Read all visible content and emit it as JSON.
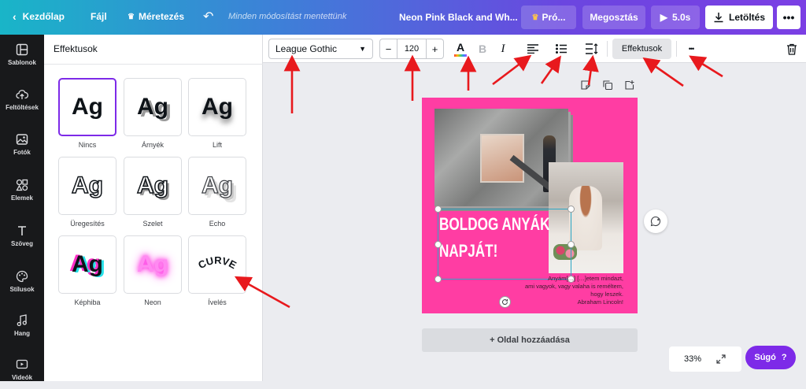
{
  "topbar": {
    "home_label": "Kezdőlap",
    "file_label": "Fájl",
    "resize_label": "Méretezés",
    "save_status": "Minden módosítást mentettünk",
    "doc_title": "Neon Pink Black and Wh...",
    "pro_label": "Pró...",
    "share_label": "Megosztás",
    "play_label": "5.0s",
    "download_label": "Letöltés"
  },
  "sidebar": {
    "items": [
      {
        "label": "Sablonok"
      },
      {
        "label": "Feltöltések"
      },
      {
        "label": "Fotók"
      },
      {
        "label": "Elemek"
      },
      {
        "label": "Szöveg"
      },
      {
        "label": "Stílusok"
      },
      {
        "label": "Hang"
      },
      {
        "label": "Videók"
      }
    ]
  },
  "panel": {
    "title": "Effektusok",
    "sample": "Ag",
    "curve_sample": "CURVE",
    "effects": [
      {
        "label": "Nincs"
      },
      {
        "label": "Árnyék"
      },
      {
        "label": "Lift"
      },
      {
        "label": "Üregesítés"
      },
      {
        "label": "Szelet"
      },
      {
        "label": "Echo"
      },
      {
        "label": "Képhiba"
      },
      {
        "label": "Neon"
      },
      {
        "label": "Ívelés"
      }
    ]
  },
  "toolbar": {
    "font": "League Gothic",
    "size": "120",
    "minus": "−",
    "plus": "+",
    "bold": "B",
    "italic": "I",
    "effects_label": "Effektusok",
    "more": "•••"
  },
  "design": {
    "headline_line1": "BOLDOG ANYÁK",
    "headline_line2": "NAPJÁT!",
    "quote_line1": "Anyám[…] […]etem mindazt,",
    "quote_line2": "ami vagyok, vagy valaha is reméltem,",
    "quote_line3": "hogy leszek.",
    "quote_author": "Abraham Lincoln!",
    "add_page": "+ Oldal hozzáadása"
  },
  "footer": {
    "zoom": "33%",
    "help_label": "Súgó",
    "help_icon": "?"
  },
  "colors": {
    "accent": "#7d2ae8",
    "design_bg": "#ff3da3",
    "arrow": "#e8191d"
  }
}
